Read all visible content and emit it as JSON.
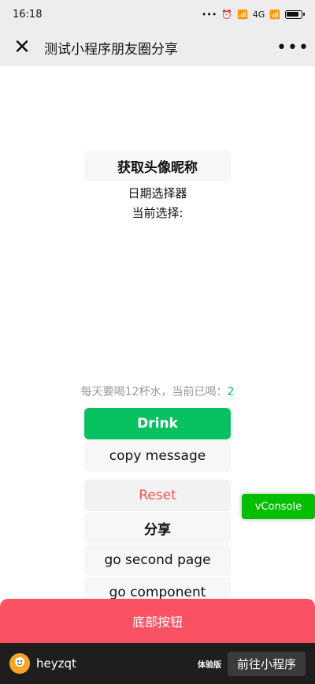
{
  "status_bar": {
    "time": "16:18",
    "signal_text": "4G"
  },
  "nav": {
    "close_icon": "close-icon",
    "title": "测试小程序朋友圈分享",
    "more_icon": "more-icon"
  },
  "main": {
    "avatar_button": "获取头像昵称",
    "date_picker_label": "日期选择器",
    "current_selection_label": "当前选择:",
    "water_counter": {
      "prefix": "每天要喝12杯水，当前已喝：",
      "value": "2"
    },
    "drink_button": "Drink",
    "copy_button": "copy message",
    "reset_button": "Reset",
    "share_button": "分享",
    "second_page_button": "go second page",
    "component_button": "go component"
  },
  "vconsole": {
    "label": "vConsole"
  },
  "bottom_button": {
    "label": "底部按钮"
  },
  "footer": {
    "username": "heyzqt",
    "tag": "体验版",
    "open_button": "前往小程序"
  },
  "colors": {
    "primary_green": "#07c160",
    "danger_red": "#fa5151",
    "bottom_red": "#fa5262",
    "vconsole_green": "#04be02"
  }
}
